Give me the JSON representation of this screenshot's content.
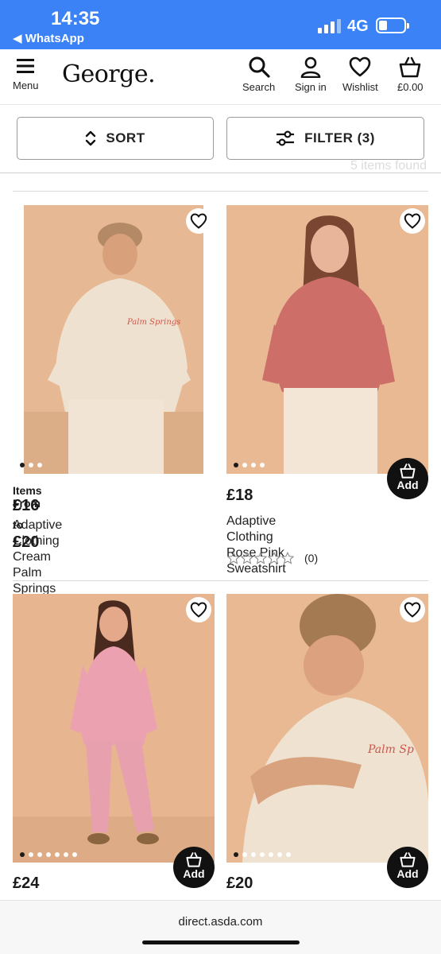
{
  "status_bar": {
    "time": "14:35",
    "back_app": "◀ WhatsApp",
    "network": "4G"
  },
  "header": {
    "menu_label": "Menu",
    "logo": "George.",
    "search_label": "Search",
    "signin_label": "Sign in",
    "wishlist_label": "Wishlist",
    "basket_label": "£0.00"
  },
  "toolbar": {
    "sort_label": "SORT",
    "filter_label": "FILTER (3)",
    "results_text": "5 items found"
  },
  "products": [
    {
      "items_from": "Items From",
      "price_from": "£16",
      "price_to_word": "to",
      "price_to": "£20",
      "name_line1": "Adaptive Clothing Cream",
      "name_line2": "Palm Springs Hoodie and…",
      "image_dots": 3,
      "active_dot": 1
    },
    {
      "price": "£18",
      "name_line1": "Adaptive Clothing Rose Pink",
      "name_line2": "Sweatshirt",
      "rating": 0,
      "rating_count": "(0)",
      "add_label": "Add",
      "image_dots": 4,
      "active_dot": 1
    },
    {
      "price": "£24",
      "add_label": "Add",
      "image_dots": 7,
      "active_dot": 1
    },
    {
      "price": "£20",
      "add_label": "Add",
      "image_dots": 7,
      "active_dot": 1
    }
  ],
  "browser": {
    "url": "direct.asda.com"
  },
  "colors": {
    "status_bar": "#3b82f6",
    "add_button": "#111111",
    "image_background": "#e2b08a"
  }
}
